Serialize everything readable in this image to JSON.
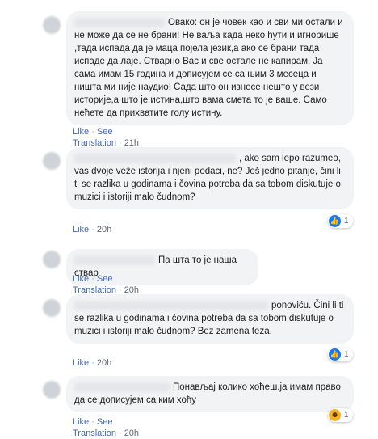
{
  "comments": [
    {
      "text": "Овако: он је човек као и сви ми остали и не може да се не брани! Не ваља када неко ћути и игнорише ,тада испада да је маца појела језик,а ако се брани тада испаде да лаје. Стварно Вас и све остале не капирам. Ја сама имам 15 година и дописујем се са њим 3 месеца и ништа ми није наудио! Сада што он изнесе нешто у вези историје,а што је истина,што вама смета то је ваше. Само нећете да прихватите голу истину.",
      "like": "Like",
      "translation": "See Translation",
      "time": "21h"
    },
    {
      "text": ", ako sam lepo razumeo, vas dvoje veže istorija i njeni podaci, ne? Još jedno pitanje, čini li ti se razlika u godinama i čovina potreba da sa tobom diskutuje o muzici i istoriji malo čudnom?",
      "like": "Like",
      "time": "20h",
      "reaction_count": "1",
      "reaction_icon": "like-icon"
    },
    {
      "text": "Па шта то је наша ствар",
      "like": "Like",
      "translation": "See Translation",
      "time": "20h"
    },
    {
      "text": "ponoviću. Čini li ti se razlika u godinama i čovina potreba da sa tobom diskutuje o muzici i istoriji malo čudnom? Bez zamena teza.",
      "like": "Like",
      "time": "20h",
      "reaction_count": "1",
      "reaction_icon": "like-icon"
    },
    {
      "text": "Понављај колико хоћеш.ја имам право да се дописујем са ким хоћу",
      "like": "Like",
      "translation": "See Translation",
      "time": "20h",
      "reaction_count": "1",
      "reaction_icon": "haha-icon"
    }
  ],
  "separator": "·",
  "colors": {
    "link": "#4267b2",
    "bubble": "#f2f3f5",
    "like": "#1877f2",
    "haha": "#f7b125"
  }
}
